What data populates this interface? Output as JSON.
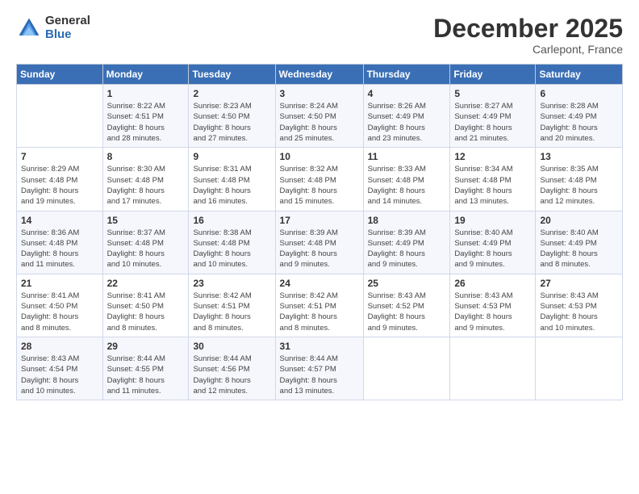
{
  "logo": {
    "general": "General",
    "blue": "Blue"
  },
  "title": "December 2025",
  "location": "Carlepont, France",
  "days_header": [
    "Sunday",
    "Monday",
    "Tuesday",
    "Wednesday",
    "Thursday",
    "Friday",
    "Saturday"
  ],
  "weeks": [
    [
      {
        "day": "",
        "info": ""
      },
      {
        "day": "1",
        "info": "Sunrise: 8:22 AM\nSunset: 4:51 PM\nDaylight: 8 hours\nand 28 minutes."
      },
      {
        "day": "2",
        "info": "Sunrise: 8:23 AM\nSunset: 4:50 PM\nDaylight: 8 hours\nand 27 minutes."
      },
      {
        "day": "3",
        "info": "Sunrise: 8:24 AM\nSunset: 4:50 PM\nDaylight: 8 hours\nand 25 minutes."
      },
      {
        "day": "4",
        "info": "Sunrise: 8:26 AM\nSunset: 4:49 PM\nDaylight: 8 hours\nand 23 minutes."
      },
      {
        "day": "5",
        "info": "Sunrise: 8:27 AM\nSunset: 4:49 PM\nDaylight: 8 hours\nand 21 minutes."
      },
      {
        "day": "6",
        "info": "Sunrise: 8:28 AM\nSunset: 4:49 PM\nDaylight: 8 hours\nand 20 minutes."
      }
    ],
    [
      {
        "day": "7",
        "info": "Sunrise: 8:29 AM\nSunset: 4:48 PM\nDaylight: 8 hours\nand 19 minutes."
      },
      {
        "day": "8",
        "info": "Sunrise: 8:30 AM\nSunset: 4:48 PM\nDaylight: 8 hours\nand 17 minutes."
      },
      {
        "day": "9",
        "info": "Sunrise: 8:31 AM\nSunset: 4:48 PM\nDaylight: 8 hours\nand 16 minutes."
      },
      {
        "day": "10",
        "info": "Sunrise: 8:32 AM\nSunset: 4:48 PM\nDaylight: 8 hours\nand 15 minutes."
      },
      {
        "day": "11",
        "info": "Sunrise: 8:33 AM\nSunset: 4:48 PM\nDaylight: 8 hours\nand 14 minutes."
      },
      {
        "day": "12",
        "info": "Sunrise: 8:34 AM\nSunset: 4:48 PM\nDaylight: 8 hours\nand 13 minutes."
      },
      {
        "day": "13",
        "info": "Sunrise: 8:35 AM\nSunset: 4:48 PM\nDaylight: 8 hours\nand 12 minutes."
      }
    ],
    [
      {
        "day": "14",
        "info": "Sunrise: 8:36 AM\nSunset: 4:48 PM\nDaylight: 8 hours\nand 11 minutes."
      },
      {
        "day": "15",
        "info": "Sunrise: 8:37 AM\nSunset: 4:48 PM\nDaylight: 8 hours\nand 10 minutes."
      },
      {
        "day": "16",
        "info": "Sunrise: 8:38 AM\nSunset: 4:48 PM\nDaylight: 8 hours\nand 10 minutes."
      },
      {
        "day": "17",
        "info": "Sunrise: 8:39 AM\nSunset: 4:48 PM\nDaylight: 8 hours\nand 9 minutes."
      },
      {
        "day": "18",
        "info": "Sunrise: 8:39 AM\nSunset: 4:49 PM\nDaylight: 8 hours\nand 9 minutes."
      },
      {
        "day": "19",
        "info": "Sunrise: 8:40 AM\nSunset: 4:49 PM\nDaylight: 8 hours\nand 9 minutes."
      },
      {
        "day": "20",
        "info": "Sunrise: 8:40 AM\nSunset: 4:49 PM\nDaylight: 8 hours\nand 8 minutes."
      }
    ],
    [
      {
        "day": "21",
        "info": "Sunrise: 8:41 AM\nSunset: 4:50 PM\nDaylight: 8 hours\nand 8 minutes."
      },
      {
        "day": "22",
        "info": "Sunrise: 8:41 AM\nSunset: 4:50 PM\nDaylight: 8 hours\nand 8 minutes."
      },
      {
        "day": "23",
        "info": "Sunrise: 8:42 AM\nSunset: 4:51 PM\nDaylight: 8 hours\nand 8 minutes."
      },
      {
        "day": "24",
        "info": "Sunrise: 8:42 AM\nSunset: 4:51 PM\nDaylight: 8 hours\nand 8 minutes."
      },
      {
        "day": "25",
        "info": "Sunrise: 8:43 AM\nSunset: 4:52 PM\nDaylight: 8 hours\nand 9 minutes."
      },
      {
        "day": "26",
        "info": "Sunrise: 8:43 AM\nSunset: 4:53 PM\nDaylight: 8 hours\nand 9 minutes."
      },
      {
        "day": "27",
        "info": "Sunrise: 8:43 AM\nSunset: 4:53 PM\nDaylight: 8 hours\nand 10 minutes."
      }
    ],
    [
      {
        "day": "28",
        "info": "Sunrise: 8:43 AM\nSunset: 4:54 PM\nDaylight: 8 hours\nand 10 minutes."
      },
      {
        "day": "29",
        "info": "Sunrise: 8:44 AM\nSunset: 4:55 PM\nDaylight: 8 hours\nand 11 minutes."
      },
      {
        "day": "30",
        "info": "Sunrise: 8:44 AM\nSunset: 4:56 PM\nDaylight: 8 hours\nand 12 minutes."
      },
      {
        "day": "31",
        "info": "Sunrise: 8:44 AM\nSunset: 4:57 PM\nDaylight: 8 hours\nand 13 minutes."
      },
      {
        "day": "",
        "info": ""
      },
      {
        "day": "",
        "info": ""
      },
      {
        "day": "",
        "info": ""
      }
    ]
  ]
}
